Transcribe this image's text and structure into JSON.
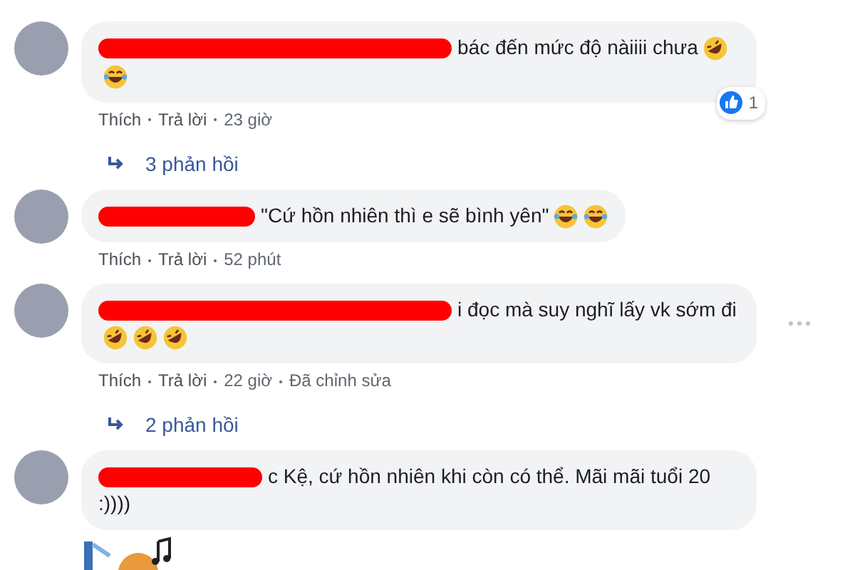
{
  "comments": [
    {
      "name_redacted": true,
      "text": "bác đến mức độ nàiiii chưa",
      "emojis": [
        {
          "kind": "rofl"
        },
        {
          "kind": "joy"
        }
      ],
      "actions": [
        "Thích",
        "Trả lời"
      ],
      "time": "23 giờ",
      "reaction_count": "1",
      "replies": "3 phản hồi"
    },
    {
      "name_redacted": true,
      "text": "\"Cứ hồn nhiên thì e sẽ bình yên\"",
      "emojis": [
        {
          "kind": "joy"
        },
        {
          "kind": "joy"
        }
      ],
      "actions": [
        "Thích",
        "Trả lời"
      ],
      "time": "52 phút"
    },
    {
      "name_redacted": true,
      "text": "i đọc mà suy nghĩ lấy vk sớm đi",
      "emojis": [
        {
          "kind": "rofl"
        },
        {
          "kind": "rofl"
        },
        {
          "kind": "rofl"
        }
      ],
      "actions": [
        "Thích",
        "Trả lời"
      ],
      "time": "22 giờ",
      "edited": "Đã chỉnh sửa",
      "more": true,
      "replies": "2 phản hồi"
    },
    {
      "name_redacted": true,
      "text": "c Kệ, cứ hồn nhiên khi còn có thể. Mãi mãi tuổi 20 :))))",
      "sticker": true
    }
  ]
}
